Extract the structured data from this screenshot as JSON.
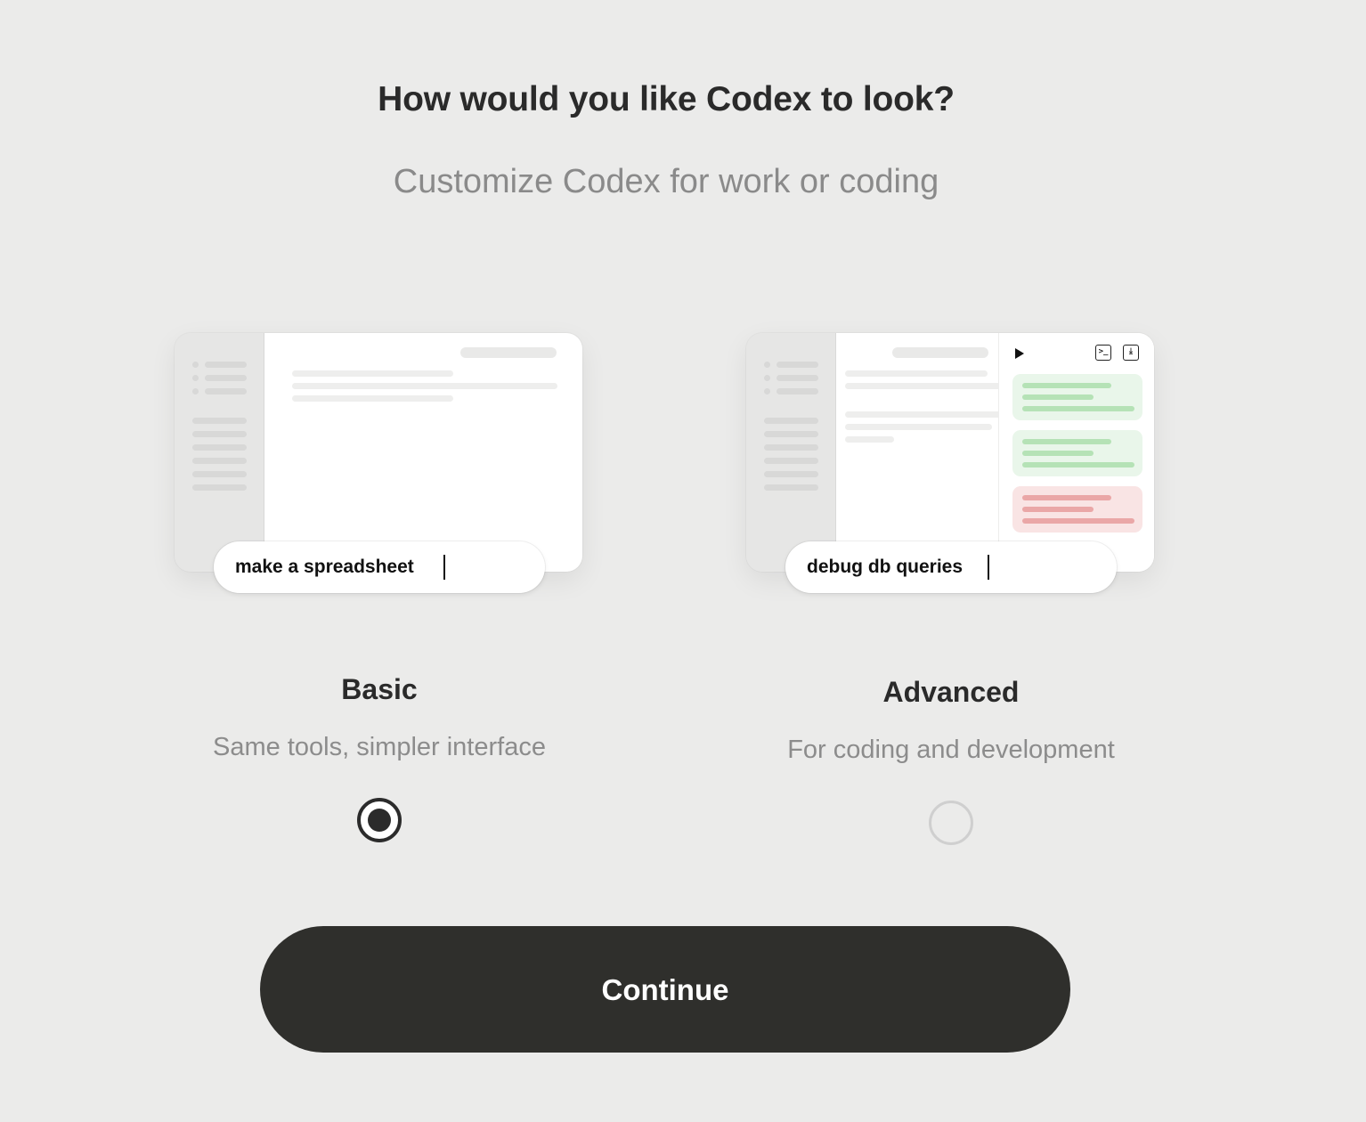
{
  "header": {
    "title": "How would you like Codex to look?",
    "subtitle": "Customize Codex for work or coding"
  },
  "options": [
    {
      "id": "basic",
      "title": "Basic",
      "description": "Same tools, simpler interface",
      "prompt_text": "make a spreadsheet",
      "selected": true
    },
    {
      "id": "advanced",
      "title": "Advanced",
      "description": "For coding and development",
      "prompt_text": "debug db queries",
      "selected": false
    }
  ],
  "icons": {
    "play": "play-icon",
    "terminal": "terminal-icon",
    "download": "download-icon",
    "terminal_glyph": ">_",
    "download_glyph": "⤓"
  },
  "actions": {
    "continue_label": "Continue"
  },
  "colors": {
    "background": "#ebebea",
    "button": "#2f2f2c",
    "success_card": "#e9f6ea",
    "error_card": "#f9e4e4"
  }
}
